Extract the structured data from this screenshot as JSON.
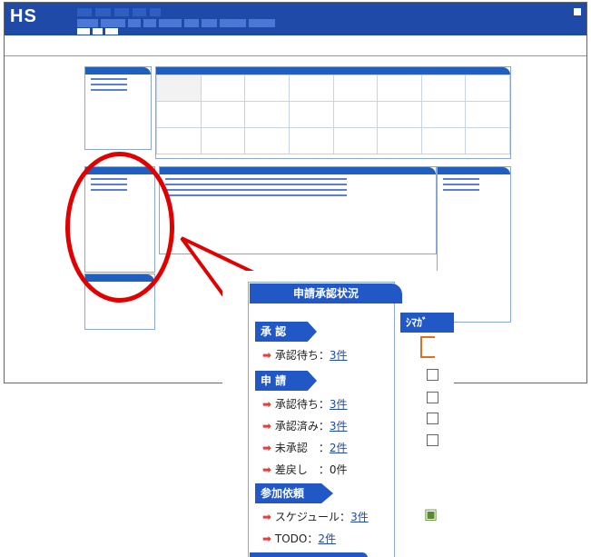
{
  "app": {
    "logo": "HS"
  },
  "nav": {
    "close_label": ""
  },
  "zoom": {
    "title": "申請承認状況",
    "right_title": "ｼﾏｶﾞ",
    "sections": [
      {
        "label": "承 認",
        "items": [
          {
            "label": "承認待ち：",
            "value": "3件"
          }
        ]
      },
      {
        "label": "申 請",
        "items": [
          {
            "label": "承認待ち：",
            "value": "3件"
          },
          {
            "label": "承認済み：",
            "value": "3件"
          },
          {
            "label": "未承認　：",
            "value": "2件"
          },
          {
            "label": "差戻し　：",
            "value": "0件"
          }
        ]
      },
      {
        "label": "参加依頼",
        "items": [
          {
            "label": "スケジュール：",
            "value": "3件"
          },
          {
            "label": "TODO：",
            "value": "2件"
          }
        ]
      }
    ]
  },
  "colors": {
    "accent": "#2257c6",
    "highlight": "#e00000"
  }
}
